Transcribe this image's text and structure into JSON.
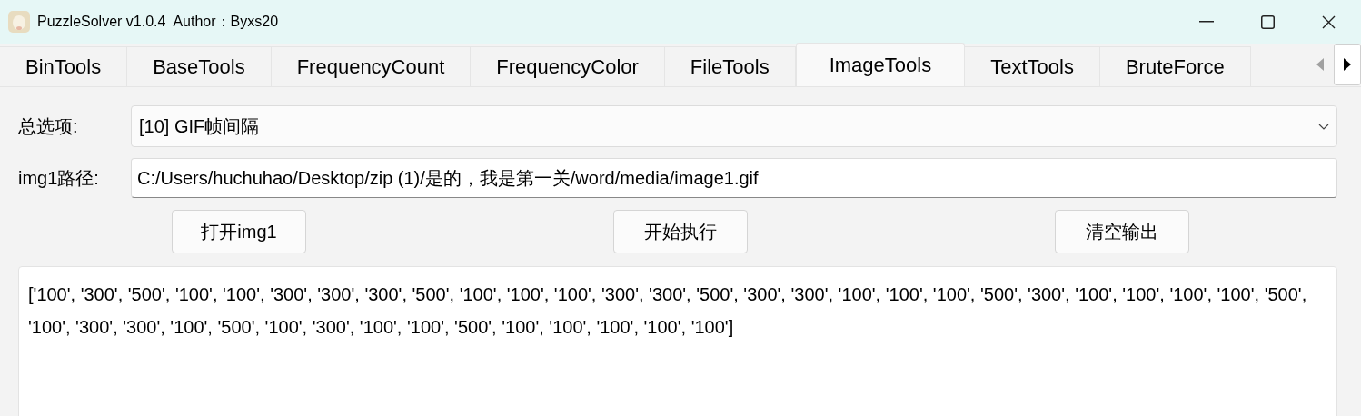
{
  "window": {
    "title": "PuzzleSolver v1.0.4  Author：Byxs20"
  },
  "tabs": [
    {
      "label": "BinTools",
      "selected": false
    },
    {
      "label": "BaseTools",
      "selected": false
    },
    {
      "label": "FrequencyCount",
      "selected": false
    },
    {
      "label": "FrequencyColor",
      "selected": false
    },
    {
      "label": "FileTools",
      "selected": false
    },
    {
      "label": "ImageTools",
      "selected": true
    },
    {
      "label": "TextTools",
      "selected": false
    },
    {
      "label": "BruteForce",
      "selected": false
    }
  ],
  "form": {
    "option_label": "总选项:",
    "option_value": "[10] GIF帧间隔",
    "path_label": "img1路径:",
    "path_value": "C:/Users/huchuhao/Desktop/zip (1)/是的，我是第一关/word/media/image1.gif"
  },
  "buttons": [
    "打开img1",
    "开始执行",
    "清空输出"
  ],
  "output": "['100', '300', '500', '100', '100', '300', '300', '300', '500', '100', '100', '100', '300', '300', '500', '300', '300', '100', '100', '100', '500', '300', '100', '100', '100', '100', '500', '100', '300', '300', '100', '500', '100', '300', '100', '100', '500', '100', '100', '100', '100', '100']"
}
